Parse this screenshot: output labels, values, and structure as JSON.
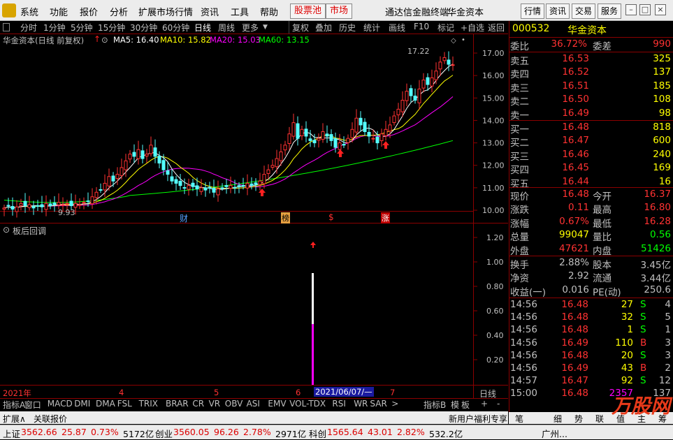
{
  "menubar": {
    "items": [
      "系统",
      "功能",
      "报价",
      "分析",
      "扩展市场行情",
      "资讯",
      "工具",
      "帮助"
    ],
    "boxed": [
      "股票池",
      "市场"
    ],
    "app_title": "通达信金融终端",
    "stock_name": "华金资本",
    "right_buttons": [
      "行情",
      "资讯",
      "交易",
      "服务"
    ]
  },
  "periods": [
    "分时",
    "1分钟",
    "5分钟",
    "15分钟",
    "30分钟",
    "60分钟",
    "日线",
    "周线",
    "更多"
  ],
  "period_selected": "日线",
  "tools": [
    "复权",
    "叠加",
    "历史",
    "统计",
    "画线",
    "F10",
    "标记",
    "+自选",
    "返回"
  ],
  "info": {
    "title": "华金资本(日线 前复权)",
    "ma5": "MA5: 16.40",
    "ma10": "MA10: 15.82",
    "ma20": "MA20: 15.03",
    "ma60": "MA60: 13.15"
  },
  "colors": {
    "ma5": "#ffffff",
    "ma10": "#ffff00",
    "ma20": "#ff00ff",
    "ma60": "#00ff00",
    "up": "#ff3232",
    "down": "#54ffff"
  },
  "chart_data": {
    "type": "candlestick",
    "price_ticks": [
      "17.00",
      "16.00",
      "15.00",
      "14.00",
      "13.00",
      "12.00",
      "11.00",
      "10.00"
    ],
    "high_label": "17.22",
    "low_label": "9.93",
    "event_markers": [
      "财",
      "榜",
      "$",
      "涨"
    ],
    "x_labels": [
      "2021年",
      "4",
      "5",
      "6",
      "2021/06/07/—",
      "7"
    ],
    "sub_panel": {
      "title": "板后回调",
      "ticks": [
        "1.20",
        "1.00",
        "0.80",
        "0.60",
        "0.40",
        "0.20"
      ],
      "bar_value_white_top": 0.9,
      "bar_value_magenta_top": 0.5
    }
  },
  "quote": {
    "code": "000532",
    "name": "华金资本",
    "weibi_label": "委比",
    "weibi": "36.72%",
    "weicha_label": "委差",
    "weicha": "990",
    "asks": [
      {
        "label": "卖五",
        "price": "16.53",
        "vol": "325"
      },
      {
        "label": "卖四",
        "price": "16.52",
        "vol": "137"
      },
      {
        "label": "卖三",
        "price": "16.51",
        "vol": "185"
      },
      {
        "label": "卖二",
        "price": "16.50",
        "vol": "108"
      },
      {
        "label": "卖一",
        "price": "16.49",
        "vol": "98"
      }
    ],
    "bids": [
      {
        "label": "买一",
        "price": "16.48",
        "vol": "818"
      },
      {
        "label": "买二",
        "price": "16.47",
        "vol": "600"
      },
      {
        "label": "买三",
        "price": "16.46",
        "vol": "240"
      },
      {
        "label": "买四",
        "price": "16.45",
        "vol": "169"
      },
      {
        "label": "买五",
        "price": "16.44",
        "vol": "16"
      }
    ],
    "stats": [
      {
        "l1": "现价",
        "v1": "16.48",
        "c1": "#ff3232",
        "l2": "今开",
        "v2": "16.37",
        "c2": "#ff3232"
      },
      {
        "l1": "涨跌",
        "v1": "0.11",
        "c1": "#ff3232",
        "l2": "最高",
        "v2": "16.80",
        "c2": "#ff3232"
      },
      {
        "l1": "涨幅",
        "v1": "0.67%",
        "c1": "#ff3232",
        "l2": "最低",
        "v2": "16.28",
        "c2": "#ff3232"
      },
      {
        "l1": "总量",
        "v1": "99047",
        "c1": "#ffff00",
        "l2": "量比",
        "v2": "0.56",
        "c2": "#00ff00"
      },
      {
        "l1": "外盘",
        "v1": "47621",
        "c1": "#ff3232",
        "l2": "内盘",
        "v2": "51426",
        "c2": "#00ff00"
      }
    ],
    "stats2": [
      {
        "l1": "换手",
        "v1": "2.88%",
        "l2": "股本",
        "v2": "3.45亿"
      },
      {
        "l1": "净资",
        "v1": "2.92",
        "l2": "流通",
        "v2": "3.44亿"
      },
      {
        "l1": "收益(一)",
        "v1": "0.016",
        "l2": "PE(动)",
        "v2": "250.6"
      }
    ],
    "ticks": [
      {
        "t": "14:56",
        "p": "16.48",
        "v": "27",
        "s": "S",
        "n": "4"
      },
      {
        "t": "14:56",
        "p": "16.48",
        "v": "32",
        "s": "S",
        "n": "5"
      },
      {
        "t": "14:56",
        "p": "16.48",
        "v": "1",
        "s": "S",
        "n": "1"
      },
      {
        "t": "14:56",
        "p": "16.49",
        "v": "110",
        "s": "B",
        "n": "3"
      },
      {
        "t": "14:56",
        "p": "16.48",
        "v": "20",
        "s": "S",
        "n": "3"
      },
      {
        "t": "14:56",
        "p": "16.49",
        "v": "43",
        "s": "B",
        "n": "2"
      },
      {
        "t": "14:57",
        "p": "16.47",
        "v": "92",
        "s": "S",
        "n": "12"
      },
      {
        "t": "15:00",
        "p": "16.48",
        "v": "2357",
        "s": "",
        "n": "137"
      }
    ]
  },
  "indicator_tabs": [
    "指标A",
    "窗口",
    "MACD",
    "DMI",
    "DMA",
    "FSL",
    "TRIX",
    "BRAR",
    "CR",
    "VR",
    "OBV",
    "ASI",
    "EMV",
    "VOL-TDX",
    "RSI",
    "WR",
    "SAR",
    ">"
  ],
  "indicator_right": [
    "指标B",
    "模",
    "板",
    "+",
    "-"
  ],
  "bottom_tabs": [
    "扩展∧",
    "关联报价"
  ],
  "right_tabs": [
    "新用户福利专享",
    "笔",
    "细",
    "势",
    "联",
    "值",
    "主",
    "筹"
  ],
  "period_label": "日线",
  "status": [
    {
      "name": "上证",
      "price": "3562.66",
      "chg": "25.87",
      "pct": "0.73%",
      "amt": "5172亿"
    },
    {
      "name": "创业",
      "price": "3560.05",
      "chg": "96.26",
      "pct": "2.78%",
      "amt": "2971亿"
    },
    {
      "name": "科创",
      "price": "1565.64",
      "chg": "43.01",
      "pct": "2.82%",
      "amt": "532.2亿"
    }
  ],
  "city": "广州...",
  "watermark": "万股网"
}
